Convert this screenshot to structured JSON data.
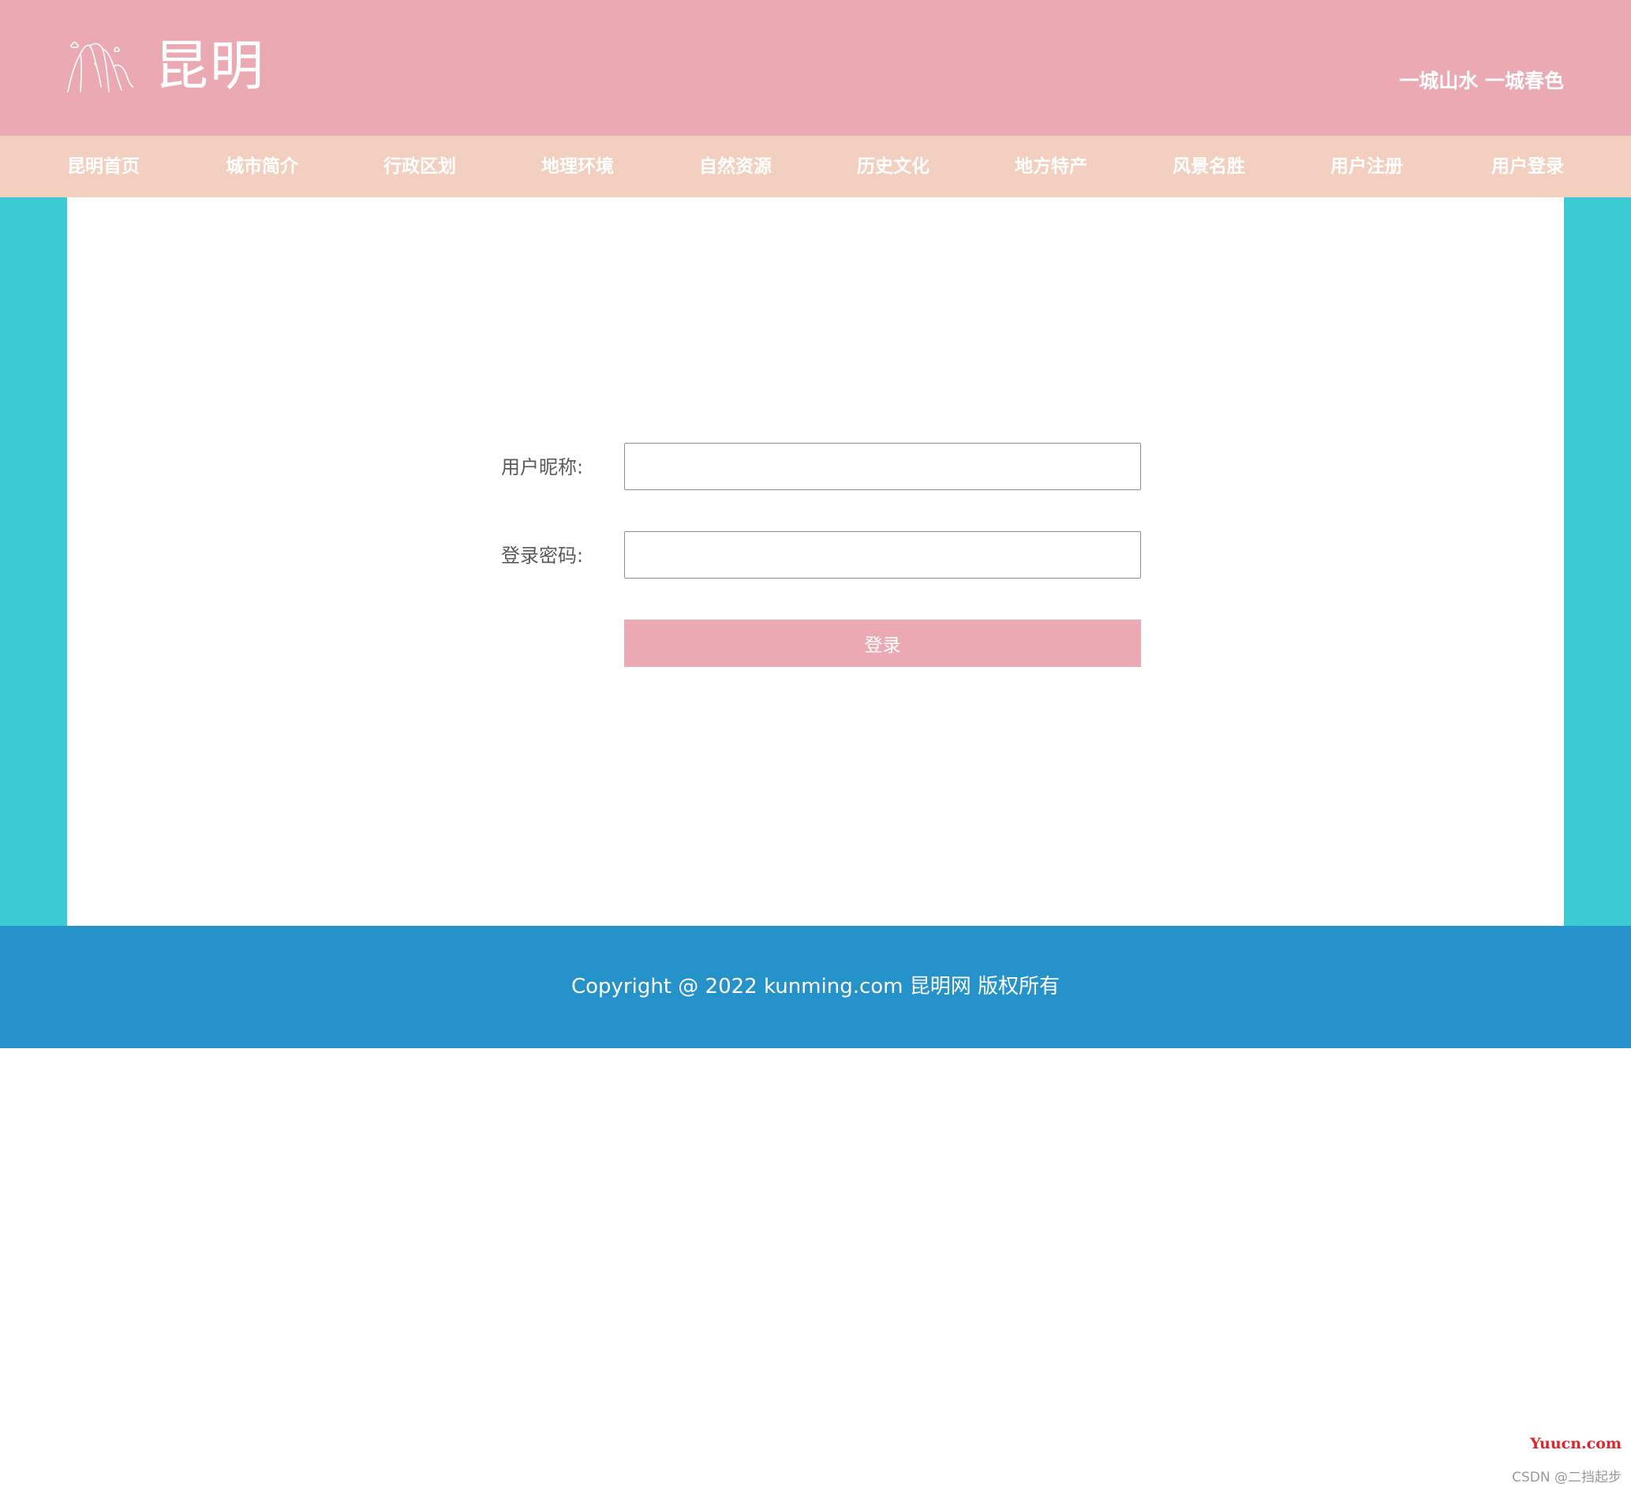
{
  "header": {
    "logo_icon": "mountain-line-icon",
    "title": "昆明",
    "slogan": "一城山水 一城春色",
    "colors": {
      "background": "#ebaab3",
      "text": "#ffffff"
    }
  },
  "nav": {
    "colors": {
      "background": "#f2cfbe",
      "text": "#ffffff"
    },
    "items": [
      {
        "label": "昆明首页"
      },
      {
        "label": "城市简介"
      },
      {
        "label": "行政区划"
      },
      {
        "label": "地理环境"
      },
      {
        "label": "自然资源"
      },
      {
        "label": "历史文化"
      },
      {
        "label": "地方特产"
      },
      {
        "label": "风景名胜"
      },
      {
        "label": "用户注册"
      },
      {
        "label": "用户登录"
      }
    ]
  },
  "login_form": {
    "username_label": "用户昵称:",
    "username_value": "",
    "password_label": "登录密码:",
    "password_value": "",
    "submit_label": "登录",
    "colors": {
      "button": "#ebaab3",
      "side_background": "#3ccbd5",
      "panel": "#ffffff"
    }
  },
  "footer": {
    "copyright": "Copyright @ 2022 kunming.com 昆明网 版权所有",
    "colors": {
      "background": "#2592c9",
      "text": "#ffffff"
    }
  },
  "watermarks": {
    "site": "Yuucn.com",
    "author": "CSDN @二挡起步"
  }
}
